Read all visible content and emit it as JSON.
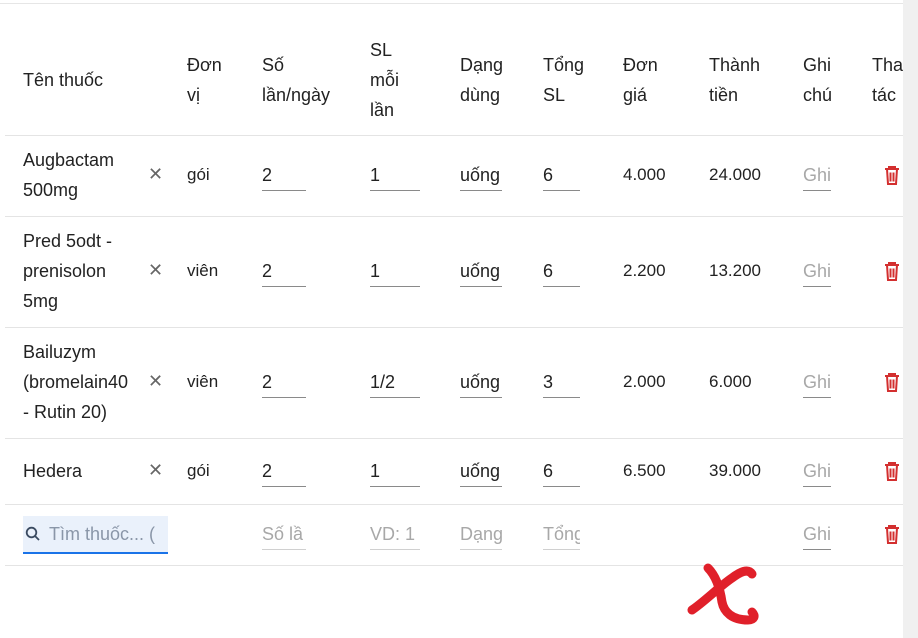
{
  "headers": {
    "name": "Tên thuốc",
    "unit": [
      "Đơn",
      "vị"
    ],
    "times": [
      "Số",
      "lần/ngày"
    ],
    "per_time": [
      "SL",
      "mỗi",
      "lần"
    ],
    "form": [
      "Dạng",
      "dùng"
    ],
    "total": [
      "Tổng",
      "SL"
    ],
    "price": [
      "Đơn",
      "giá"
    ],
    "amount": [
      "Thành",
      "tiền"
    ],
    "note": [
      "Ghi",
      "chú"
    ],
    "action": [
      "Tha",
      "tác"
    ]
  },
  "rows": [
    {
      "name": [
        "Augbactam",
        "500mg"
      ],
      "unit": "gói",
      "times": "2",
      "per_time": "1",
      "form": "uống",
      "total": "6",
      "price": "4.000",
      "amount": "24.000",
      "note_ph": "Ghi"
    },
    {
      "name": [
        "Pred 5odt -",
        "prenisolon",
        "5mg"
      ],
      "unit": "viên",
      "times": "2",
      "per_time": "1",
      "form": "uống",
      "total": "6",
      "price": "2.200",
      "amount": "13.200",
      "note_ph": "Ghi"
    },
    {
      "name": [
        "Bailuzym",
        "(bromelain40",
        "- Rutin 20)"
      ],
      "unit": "viên",
      "times": "2",
      "per_time": "1/2",
      "form": "uống",
      "total": "3",
      "price": "2.000",
      "amount": "6.000",
      "note_ph": "Ghi"
    },
    {
      "name": [
        "Hedera"
      ],
      "unit": "gói",
      "times": "2",
      "per_time": "1",
      "form": "uống",
      "total": "6",
      "price": "6.500",
      "amount": "39.000",
      "note_ph": "Ghi"
    }
  ],
  "new_row": {
    "search_placeholder": "Tìm thuốc... (",
    "times_placeholder": "Số lầ",
    "per_time_placeholder": "VD: 1",
    "form_placeholder": "Dạng",
    "total_placeholder": "Tổng",
    "note_placeholder": "Ghi"
  },
  "icons": {
    "clear": "close-icon",
    "delete": "trash-icon",
    "search": "search-icon"
  },
  "colors": {
    "delete": "#d32f2f",
    "search_focus": "#1a73e8",
    "annotation": "#e0202a"
  }
}
